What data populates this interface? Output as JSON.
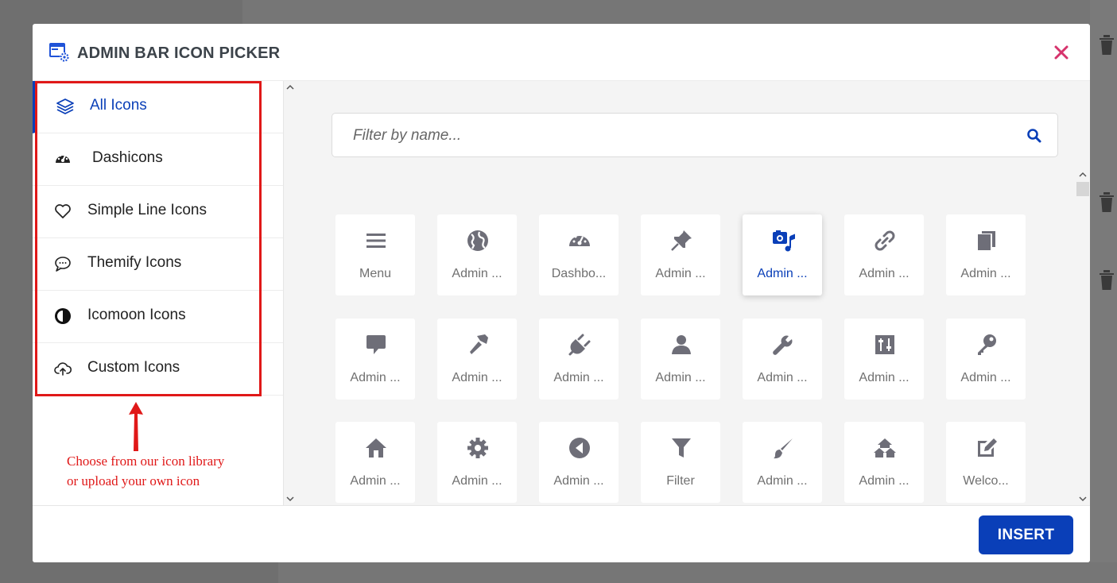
{
  "modal": {
    "title": "ADMIN BAR ICON PICKER",
    "close_icon": "close-icon",
    "accent_color": "#0a3fb8",
    "close_color": "#d6336c"
  },
  "sidebar": {
    "items": [
      {
        "label": "All Icons",
        "icon": "layers-icon",
        "active": true
      },
      {
        "label": "Dashicons",
        "icon": "dashboard-icon",
        "active": false
      },
      {
        "label": "Simple Line Icons",
        "icon": "heart-icon",
        "active": false
      },
      {
        "label": "Themify Icons",
        "icon": "chat-icon",
        "active": false
      },
      {
        "label": "Icomoon Icons",
        "icon": "contrast-icon",
        "active": false
      },
      {
        "label": "Custom Icons",
        "icon": "cloud-upload-icon",
        "active": false
      }
    ]
  },
  "annotation": {
    "line1": "Choose from our icon library",
    "line2": "or upload your own icon",
    "color": "#e01818"
  },
  "search": {
    "placeholder": "Filter by name...",
    "value": ""
  },
  "icons": [
    {
      "label": "Menu",
      "icon": "menu-icon"
    },
    {
      "label": "Admin ...",
      "icon": "globe-icon"
    },
    {
      "label": "Dashbo...",
      "icon": "dashboard-icon"
    },
    {
      "label": "Admin ...",
      "icon": "pin-icon"
    },
    {
      "label": "Admin ...",
      "icon": "media-icon",
      "selected": true
    },
    {
      "label": "Admin ...",
      "icon": "link-icon"
    },
    {
      "label": "Admin ...",
      "icon": "pages-icon"
    },
    {
      "label": "Admin ...",
      "icon": "comment-icon"
    },
    {
      "label": "Admin ...",
      "icon": "appearance-icon"
    },
    {
      "label": "Admin ...",
      "icon": "plugins-icon"
    },
    {
      "label": "Admin ...",
      "icon": "users-icon"
    },
    {
      "label": "Admin ...",
      "icon": "tools-icon"
    },
    {
      "label": "Admin ...",
      "icon": "settings-sliders-icon"
    },
    {
      "label": "Admin ...",
      "icon": "key-icon"
    },
    {
      "label": "Admin ...",
      "icon": "home-icon"
    },
    {
      "label": "Admin ...",
      "icon": "gear-icon"
    },
    {
      "label": "Admin ...",
      "icon": "collapse-icon"
    },
    {
      "label": "Filter",
      "icon": "filter-icon"
    },
    {
      "label": "Admin ...",
      "icon": "brush-icon"
    },
    {
      "label": "Admin ...",
      "icon": "multisite-icon"
    },
    {
      "label": "Welco...",
      "icon": "edit-icon"
    },
    {
      "label": "",
      "icon": ""
    },
    {
      "label": "",
      "icon": ""
    },
    {
      "label": "",
      "icon": ""
    },
    {
      "label": "",
      "icon": ""
    },
    {
      "label": "",
      "icon": ""
    },
    {
      "label": "",
      "icon": ""
    },
    {
      "label": "",
      "icon": ""
    }
  ],
  "footer": {
    "insert_label": "INSERT"
  }
}
